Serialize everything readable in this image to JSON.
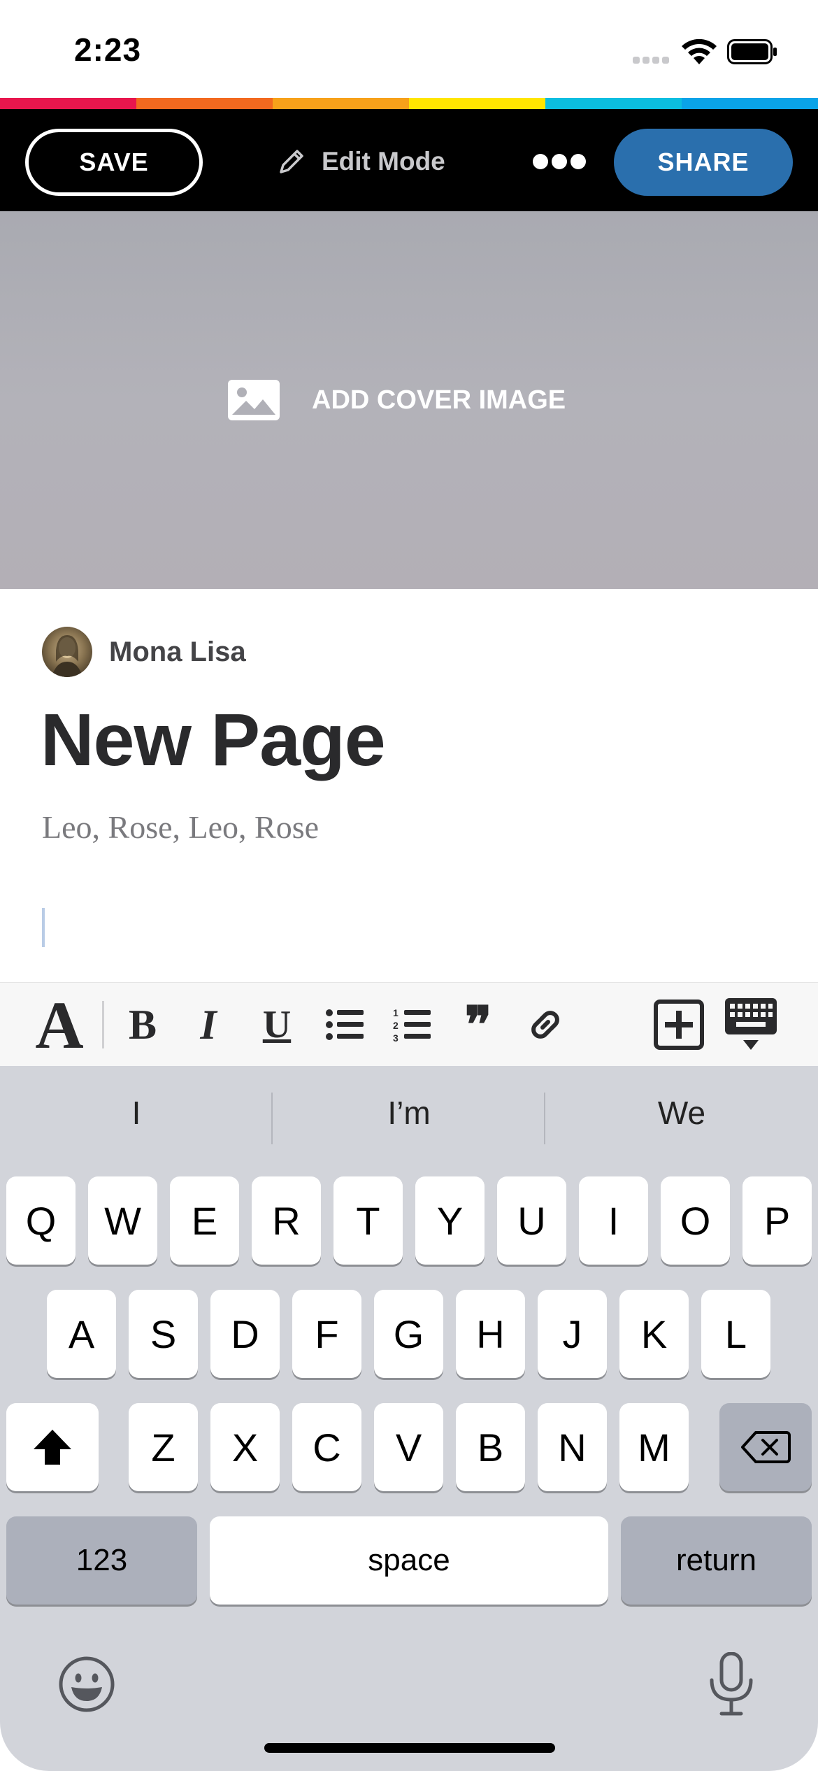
{
  "status_bar": {
    "time": "2:23"
  },
  "stripe_colors": [
    "#e8164d",
    "#f2691f",
    "#f7a11a",
    "#ffe600",
    "#0bbee0",
    "#0aa3e8"
  ],
  "toolbar": {
    "save_label": "SAVE",
    "edit_mode_label": "Edit Mode",
    "share_label": "SHARE",
    "share_color": "#2a6fad"
  },
  "cover": {
    "add_label": "ADD COVER IMAGE"
  },
  "page": {
    "author": "Mona Lisa",
    "title": "New Page",
    "subtitle": "Leo, Rose, Leo, Rose"
  },
  "format_bar": {
    "tools": [
      "text-style-icon",
      "bold-icon",
      "italic-icon",
      "underline-icon",
      "bulleted-list-icon",
      "numbered-list-icon",
      "quote-icon",
      "link-icon",
      "insert-block-icon",
      "hide-keyboard-icon"
    ],
    "bold": "B",
    "italic": "I",
    "underline": "U",
    "text_style": "A",
    "quote": "❞"
  },
  "keyboard": {
    "suggestions": [
      "I",
      "I’m",
      "We"
    ],
    "row1": [
      "Q",
      "W",
      "E",
      "R",
      "T",
      "Y",
      "U",
      "I",
      "O",
      "P"
    ],
    "row2": [
      "A",
      "S",
      "D",
      "F",
      "G",
      "H",
      "J",
      "K",
      "L"
    ],
    "row3": [
      "Z",
      "X",
      "C",
      "V",
      "B",
      "N",
      "M"
    ],
    "numbers_label": "123",
    "space_label": "space",
    "return_label": "return"
  }
}
